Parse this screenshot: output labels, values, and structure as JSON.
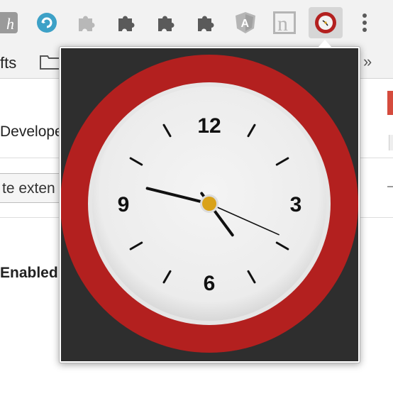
{
  "toolbar": {
    "extensions": [
      {
        "name": "toolbar-extension-k-icon"
      },
      {
        "name": "toolbar-extension-refresh-icon"
      },
      {
        "name": "toolbar-extension-puzzle-grey-icon"
      },
      {
        "name": "toolbar-extension-puzzle-1-icon"
      },
      {
        "name": "toolbar-extension-puzzle-2-icon"
      },
      {
        "name": "toolbar-extension-puzzle-3-icon"
      },
      {
        "name": "toolbar-extension-angular-icon"
      },
      {
        "name": "toolbar-extension-n-icon"
      },
      {
        "name": "toolbar-extension-clock-icon",
        "active": true
      }
    ],
    "menu_icon": "kebab-menu-icon"
  },
  "bookmarks": {
    "label": "fts",
    "more": "»"
  },
  "page": {
    "developer_text": "Develope",
    "button_text": "te exten",
    "enabled_text": "Enabled"
  },
  "popup": {
    "clock": {
      "numerals": {
        "twelve": "12",
        "three": "3",
        "six": "6",
        "nine": "9"
      },
      "time": {
        "hour": 4,
        "minute": 47,
        "second": 19
      },
      "colors": {
        "rim": "#b3201f",
        "face": "#eeeeee",
        "hub": "#d9a21a",
        "hands": "#111111",
        "background": "#2e2e2e"
      }
    }
  }
}
